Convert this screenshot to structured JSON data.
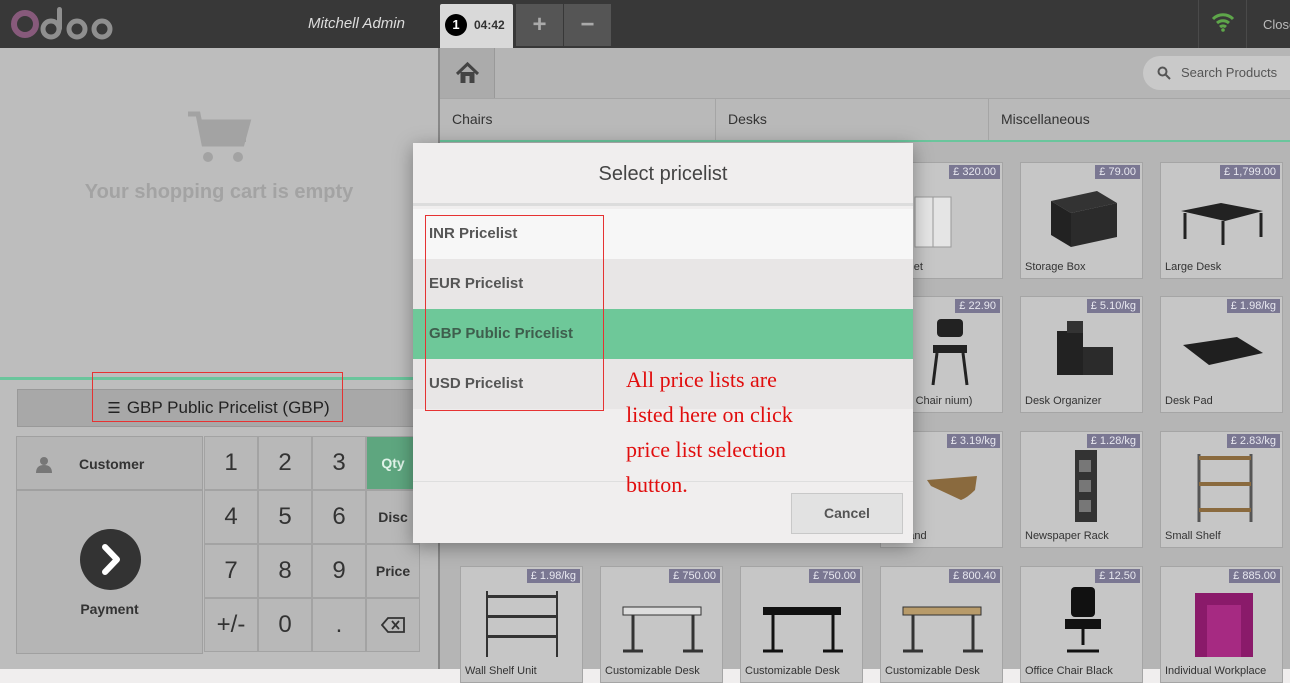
{
  "header": {
    "brand": "odoo",
    "user_name": "Mitchell Admin",
    "order_number": "1",
    "order_time": "04:42",
    "add_order_label": "+",
    "remove_order_label": "−",
    "close_label": "Close"
  },
  "cart": {
    "empty_message": "Your shopping cart is empty"
  },
  "pricelist_button": {
    "label": "GBP Public Pricelist (GBP)"
  },
  "actionpad": {
    "customer_label": "Customer",
    "payment_label": "Payment"
  },
  "numpad": {
    "keys": [
      "1",
      "2",
      "3",
      "4",
      "5",
      "6",
      "7",
      "8",
      "9",
      "+/-",
      "0",
      "."
    ],
    "modes": [
      "Qty",
      "Disc",
      "Price"
    ],
    "active_mode": "Qty"
  },
  "search": {
    "placeholder": "Search Products"
  },
  "categories": [
    "Chairs",
    "Desks",
    "Miscellaneous"
  ],
  "products": [
    {
      "name": "Cabinet",
      "price": "£ 320.00"
    },
    {
      "name": "Storage Box",
      "price": "£ 79.00"
    },
    {
      "name": "Large Desk",
      "price": "£ 1,799.00"
    },
    {
      "name": "rence Chair nium)",
      "price": "£ 22.90"
    },
    {
      "name": "Desk Organizer",
      "price": "£ 5.10/kg"
    },
    {
      "name": "Desk Pad",
      "price": "£ 1.98/kg"
    },
    {
      "name": "or Stand",
      "price": "£ 3.19/kg"
    },
    {
      "name": "Newspaper Rack",
      "price": "£ 1.28/kg"
    },
    {
      "name": "Small Shelf",
      "price": "£ 2.83/kg"
    },
    {
      "name": "Wall Shelf Unit",
      "price": "£ 1.98/kg"
    },
    {
      "name": "Customizable Desk",
      "price": "£ 750.00"
    },
    {
      "name": "Customizable Desk",
      "price": "£ 750.00"
    },
    {
      "name": "Customizable Desk",
      "price": "£ 800.40"
    },
    {
      "name": "Office Chair Black",
      "price": "£ 12.50"
    },
    {
      "name": "Individual Workplace",
      "price": "£ 885.00"
    }
  ],
  "modal": {
    "title": "Select pricelist",
    "items": [
      "INR Pricelist",
      "EUR Pricelist",
      "GBP Public Pricelist",
      "USD Pricelist"
    ],
    "selected": "GBP Public Pricelist",
    "cancel_label": "Cancel"
  },
  "annotation": {
    "text": "All price lists are listed here on click price list selection button.",
    "color": "#e10e0e"
  },
  "colors": {
    "accent": "#6ec899",
    "brand_purple": "#875a7b",
    "topbar": "#383838",
    "price_tag": "#7a7792"
  }
}
